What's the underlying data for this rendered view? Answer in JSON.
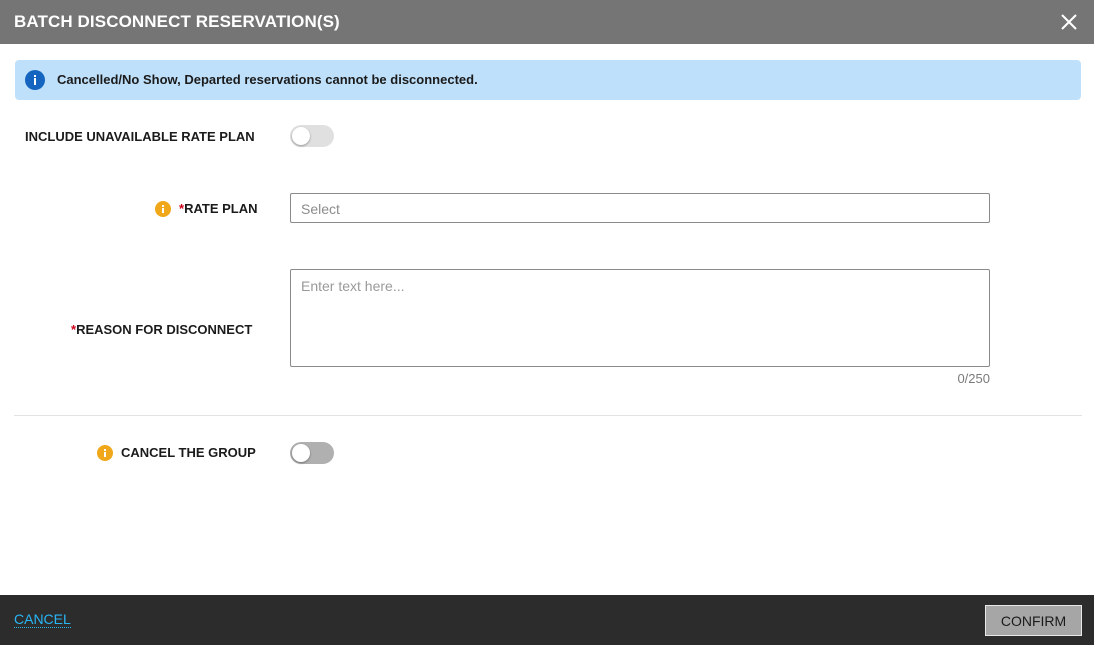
{
  "header": {
    "title": "BATCH DISCONNECT RESERVATION(S)",
    "close_icon": "close-icon"
  },
  "info_banner": {
    "icon": "info-icon",
    "message": "Cancelled/No Show, Departed reservations cannot be disconnected."
  },
  "form": {
    "include_unavailable": {
      "label": "INCLUDE UNAVAILABLE RATE PLAN",
      "toggle_on": false
    },
    "rate_plan": {
      "required_mark": "*",
      "label": "RATE PLAN",
      "placeholder": "Select",
      "info_icon": "warning-info-icon"
    },
    "reason": {
      "required_mark": "*",
      "label": "REASON FOR DISCONNECT",
      "placeholder": "Enter text here...",
      "value": "",
      "char_count": "0/250"
    },
    "cancel_group": {
      "label": "CANCEL THE GROUP",
      "toggle_on": false,
      "info_icon": "warning-info-icon"
    }
  },
  "footer": {
    "cancel_label": "CANCEL",
    "confirm_label": "CONFIRM"
  },
  "colors": {
    "header_bg": "#757575",
    "banner_bg": "#bfe0fb",
    "info_blue": "#1565c0",
    "warning_amber": "#f0a81a",
    "footer_bg": "#2c2c2c",
    "link_blue": "#29b6f6",
    "required_red": "#d0021b"
  }
}
